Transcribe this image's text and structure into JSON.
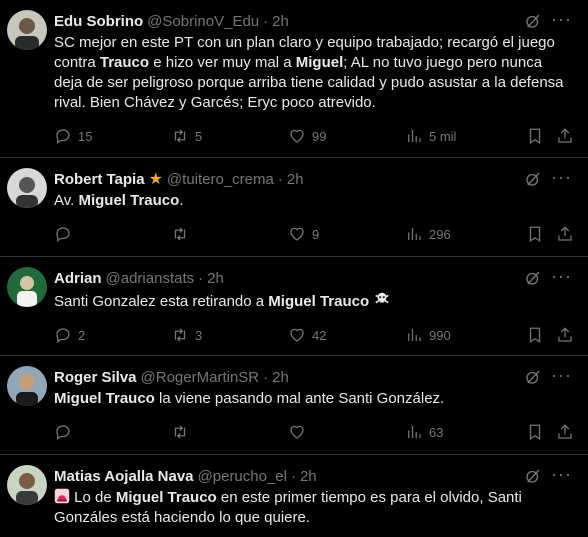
{
  "tweets": [
    {
      "name": "Edu Sobrino",
      "handle": "@SobrinoV_Edu",
      "time": "2h",
      "verified_star": false,
      "text_parts": [
        "SC mejor en este PT con un plan claro y equipo trabajado; recargó el juego contra ",
        "Trauco",
        " e hizo ver muy mal a ",
        "Miguel",
        "; AL no tuvo juego pero nunca deja de ser peligroso porque arriba tiene calidad y pudo asustar a la defensa rival. Bien Chávez y Garcés; Eryc poco atrevido."
      ],
      "replies": "15",
      "retweets": "5",
      "likes": "99",
      "views": "5 mil"
    },
    {
      "name": "Robert Tapia",
      "handle": "@tuitero_crema",
      "time": "2h",
      "verified_star": true,
      "text_parts": [
        "Av. ",
        "Miguel Trauco",
        "."
      ],
      "replies": "",
      "retweets": "",
      "likes": "9",
      "views": "296"
    },
    {
      "name": "Adrian",
      "handle": "@adrianstats",
      "time": "2h",
      "verified_star": false,
      "text_parts": [
        "Santi Gonzalez esta retirando a ",
        "Miguel Trauco",
        " "
      ],
      "replies": "2",
      "retweets": "3",
      "likes": "42",
      "views": "990"
    },
    {
      "name": "Roger Silva",
      "handle": "@RogerMartinSR",
      "time": "2h",
      "verified_star": false,
      "text_parts": [
        "",
        "Miguel Trauco",
        " la viene pasando mal ante Santi González."
      ],
      "replies": "",
      "retweets": "",
      "likes": "",
      "views": "63"
    },
    {
      "name": "Matias Aojalla Nava",
      "handle": "@perucho_el",
      "time": "2h",
      "verified_star": false,
      "text_parts": [
        " Lo de ",
        "Miguel Trauco",
        " en este primer tiempo es para el olvido, Santi Gonzáles está haciendo lo que quiere."
      ]
    }
  ],
  "icons": [
    "reply-icon",
    "retweet-icon",
    "like-icon",
    "views-icon",
    "bookmark-icon",
    "share-icon",
    "grok-icon",
    "more-icon"
  ],
  "colors": {
    "background": "#000000",
    "text": "#e7e9ea",
    "muted": "#71767b",
    "divider": "#2f3336",
    "star": "#f5a623"
  }
}
